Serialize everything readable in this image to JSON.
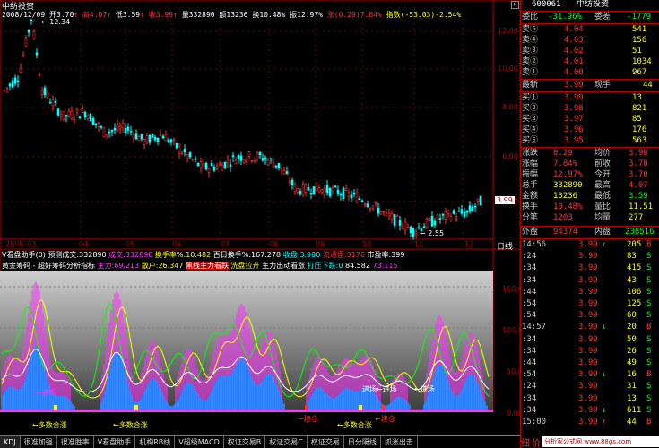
{
  "app": {
    "title": "中纺投资"
  },
  "header": {
    "date": "2008/12/09",
    "open": "开3.70",
    "high": "高4.07",
    "low": "低3.59",
    "close": "收3.99",
    "volume": "量332890",
    "amount": "额13236",
    "turnover": "换10.48%",
    "amplitude": "振12.97%",
    "change": "涨(0.29)7.84%",
    "index": "指数(-53.03)-2.54%"
  },
  "price_axis": {
    "labels": [
      "12.00",
      "10.00",
      "8.00",
      "6.00",
      "4.00"
    ],
    "current": "3.99",
    "max_note": "12.34",
    "min_note": "2.55"
  },
  "time_axis": {
    "labels": [
      "2008",
      "03",
      "04",
      "05",
      "06",
      "07",
      "08",
      "09",
      "10",
      "11",
      "12"
    ],
    "period": "日线"
  },
  "indicator1": {
    "name": "V看盘助手(0)",
    "items": [
      "预测成交:332890",
      "成交:332890",
      "换手率%:10.482",
      "百日换手%:167.278",
      "收盘:3.990",
      "流通盘:3176",
      "市盈率:399"
    ]
  },
  "indicator2": {
    "name": "黄金筹码 - 超好筹码分析指标",
    "items": [
      "主力:69.213",
      "散户:26.347",
      "黑线主力看跌",
      "洗盘拉升",
      "主力出动看涨",
      "打压下跌:0",
      "84.582",
      "73.115"
    ],
    "axis": [
      "150.00",
      "100.00",
      "50.00",
      "0.00"
    ],
    "annotations": [
      "多数合涨",
      "多数合涨",
      "多数合涨",
      "进场",
      "进场",
      "进场",
      "进场",
      "建仓",
      "建仓"
    ]
  },
  "tabs": [
    "KDJ",
    "很准加强",
    "很准胜率",
    "V看盘助手",
    "机构RB线",
    "V超级MACD",
    "权证交易B",
    "权证交易C",
    "权证交易",
    "日分隔线",
    "抓涨出击"
  ],
  "quote": {
    "code": "600061",
    "name": "中纺投资",
    "ratio_label": "委比",
    "ratio_value": "-31.96%",
    "diff_label": "委差",
    "diff_value": "-1779",
    "sells": [
      {
        "label": "卖⑤",
        "price": "4.04",
        "vol": "541"
      },
      {
        "label": "卖④",
        "price": "4.03",
        "vol": "156"
      },
      {
        "label": "卖③",
        "price": "4.02",
        "vol": "51"
      },
      {
        "label": "卖②",
        "price": "4.01",
        "vol": "1034"
      },
      {
        "label": "卖①",
        "price": "4.00",
        "vol": "967"
      }
    ],
    "latest_label": "最新",
    "latest_price": "3.99",
    "hand_label": "现手",
    "hand_value": "44",
    "buys": [
      {
        "label": "买①",
        "price": "3.99",
        "vol": "13"
      },
      {
        "label": "买②",
        "price": "3.98",
        "vol": "821"
      },
      {
        "label": "买③",
        "price": "3.97",
        "vol": "85"
      },
      {
        "label": "买④",
        "price": "3.96",
        "vol": "176"
      },
      {
        "label": "买⑤",
        "price": "3.95",
        "vol": "563"
      }
    ],
    "stats": [
      {
        "l1": "涨跌",
        "v1": "0.29",
        "l2": "均价",
        "v2": "3.98"
      },
      {
        "l1": "涨幅",
        "v1": "7.84%",
        "l2": "前收",
        "v2": "3.70"
      },
      {
        "l1": "振幅",
        "v1": "12.97%",
        "l2": "今开",
        "v2": "3.70"
      },
      {
        "l1": "总手",
        "v1": "332890",
        "l2": "最高",
        "v2": "4.07"
      },
      {
        "l1": "金额",
        "v1": "13236",
        "l2": "最低",
        "v2": "3.59"
      },
      {
        "l1": "换手",
        "v1": "10.48%",
        "l2": "量比",
        "v2": "11.51"
      },
      {
        "l1": "分笔",
        "v1": "1203",
        "l2": "均量",
        "v2": "277"
      }
    ],
    "outer_label": "外盘",
    "outer_value": "94374",
    "inner_label": "内盘",
    "inner_value": "238516"
  },
  "ticks": [
    {
      "time": "14:56",
      "price": "3.99",
      "arrow": "↑",
      "vol": "205",
      "side": "B"
    },
    {
      "time": ":24",
      "price": "3.99",
      "arrow": "",
      "vol": "83",
      "side": "S"
    },
    {
      "time": ":34",
      "price": "3.99",
      "arrow": "",
      "vol": "415",
      "side": "S"
    },
    {
      "time": ":34",
      "price": "3.99",
      "arrow": "",
      "vol": "43",
      "side": "S"
    },
    {
      "time": ":44",
      "price": "3.99",
      "arrow": "",
      "vol": "106",
      "side": "S"
    },
    {
      "time": ":54",
      "price": "3.99",
      "arrow": "",
      "vol": "125",
      "side": "S"
    },
    {
      "time": ":54",
      "price": "3.99",
      "arrow": "",
      "vol": "60",
      "side": "S"
    },
    {
      "time": "14:57",
      "price": "3.99",
      "arrow": "↓",
      "vol": "20",
      "side": "B"
    },
    {
      "time": ":34",
      "price": "3.99",
      "arrow": "",
      "vol": "50",
      "side": "S"
    },
    {
      "time": ":34",
      "price": "3.99",
      "arrow": "",
      "vol": "26",
      "side": "S"
    },
    {
      "time": ":44",
      "price": "3.99",
      "arrow": "",
      "vol": "49",
      "side": "S"
    },
    {
      "time": ":54",
      "price": "3.99",
      "arrow": "↓",
      "vol": "16",
      "side": "B"
    },
    {
      "time": ":24",
      "price": "3.99",
      "arrow": "",
      "vol": "31",
      "side": "S"
    },
    {
      "time": ":34",
      "price": "3.99",
      "arrow": "",
      "vol": "13",
      "side": "S"
    },
    {
      "time": ":34",
      "price": "3.99",
      "arrow": "↓",
      "vol": "611",
      "side": "S"
    },
    {
      "time": "15:00",
      "price": "3.99",
      "arrow": "↑",
      "vol": "44",
      "side": "B"
    }
  ],
  "footer": {
    "label1": "细",
    "label2": "价",
    "site": "分析家公式网 www.88gs.com"
  },
  "colors": {
    "up": "#ff3030",
    "down": "#00ffff",
    "magenta": "#ff33ff",
    "yellow": "#ffff00",
    "green": "#00ff00",
    "gridred": "#b00000"
  }
}
